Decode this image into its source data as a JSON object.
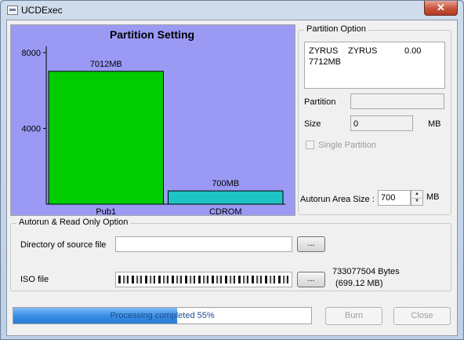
{
  "window": {
    "title": "UCDExec",
    "close_label": "✕"
  },
  "chart_data": {
    "type": "bar",
    "title": "Partition Setting",
    "categories": [
      "Pub1",
      "CDROM"
    ],
    "values": [
      7012,
      700
    ],
    "data_labels": [
      "7012MB",
      "700MB"
    ],
    "yticks": [
      "8000",
      "4000"
    ],
    "ytick_values": [
      8000,
      4000
    ],
    "ylim": [
      0,
      8000
    ],
    "colors": [
      "#00cc00",
      "#1fc4c4"
    ],
    "background": "#9a9af5",
    "grid": false
  },
  "partition_option": {
    "legend": "Partition Option",
    "info_line1_a": "ZYRUS",
    "info_line1_b": "ZYRUS",
    "info_line1_c": "0.00",
    "info_line2": "7712MB",
    "partition_label": "Partition",
    "partition_value": "",
    "size_label": "Size",
    "size_value": "0",
    "size_unit": "MB",
    "single_partition_label": "Single Partition",
    "autorun_size_label": "Autorun Area Size :",
    "autorun_size_value": "700",
    "autorun_size_unit": "MB"
  },
  "autorun_option": {
    "legend": "Autorun & Read Only Option",
    "source_dir_label": "Directory of source file",
    "source_dir_value": "",
    "browse_label": "...",
    "iso_label": "ISO file",
    "iso_browse_label": "...",
    "iso_bytes": "733077504 Bytes",
    "iso_mb": "(699.12 MB)"
  },
  "progress": {
    "percent": 55,
    "text": "Processing completed 55%"
  },
  "buttons": {
    "burn": "Burn",
    "close": "Close"
  }
}
